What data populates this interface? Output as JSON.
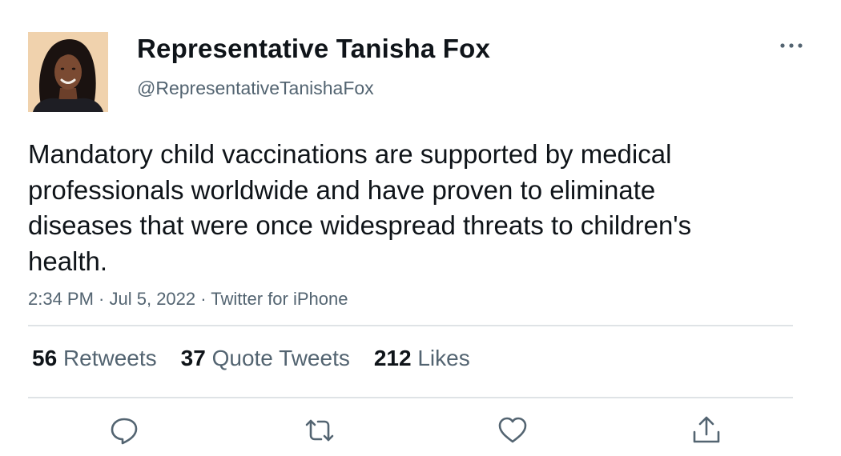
{
  "author": {
    "display_name": "Representative Tanisha Fox",
    "handle": "@RepresentativeTanishaFox"
  },
  "tweet": {
    "text": "Mandatory child vaccinations are supported by medical professionals worldwide and have proven to eliminate diseases that were once widespread threats to children's health.",
    "time": "2:34 PM",
    "separator": " · ",
    "date": "Jul 5, 2022",
    "source": "Twitter for iPhone"
  },
  "stats": {
    "retweets": {
      "count": "56",
      "label": "Retweets"
    },
    "quote_tweets": {
      "count": "37",
      "label": "Quote Tweets"
    },
    "likes": {
      "count": "212",
      "label": "Likes"
    }
  },
  "actions": {
    "reply_icon": "speech-bubble-icon",
    "retweet_icon": "retweet-arrows-icon",
    "like_icon": "heart-icon",
    "share_icon": "share-upload-icon",
    "more_icon": "three-dots-icon"
  },
  "colors": {
    "primary_text": "#0f1419",
    "secondary_text": "#536471",
    "divider": "#dfe3e6",
    "icon": "#536471"
  }
}
